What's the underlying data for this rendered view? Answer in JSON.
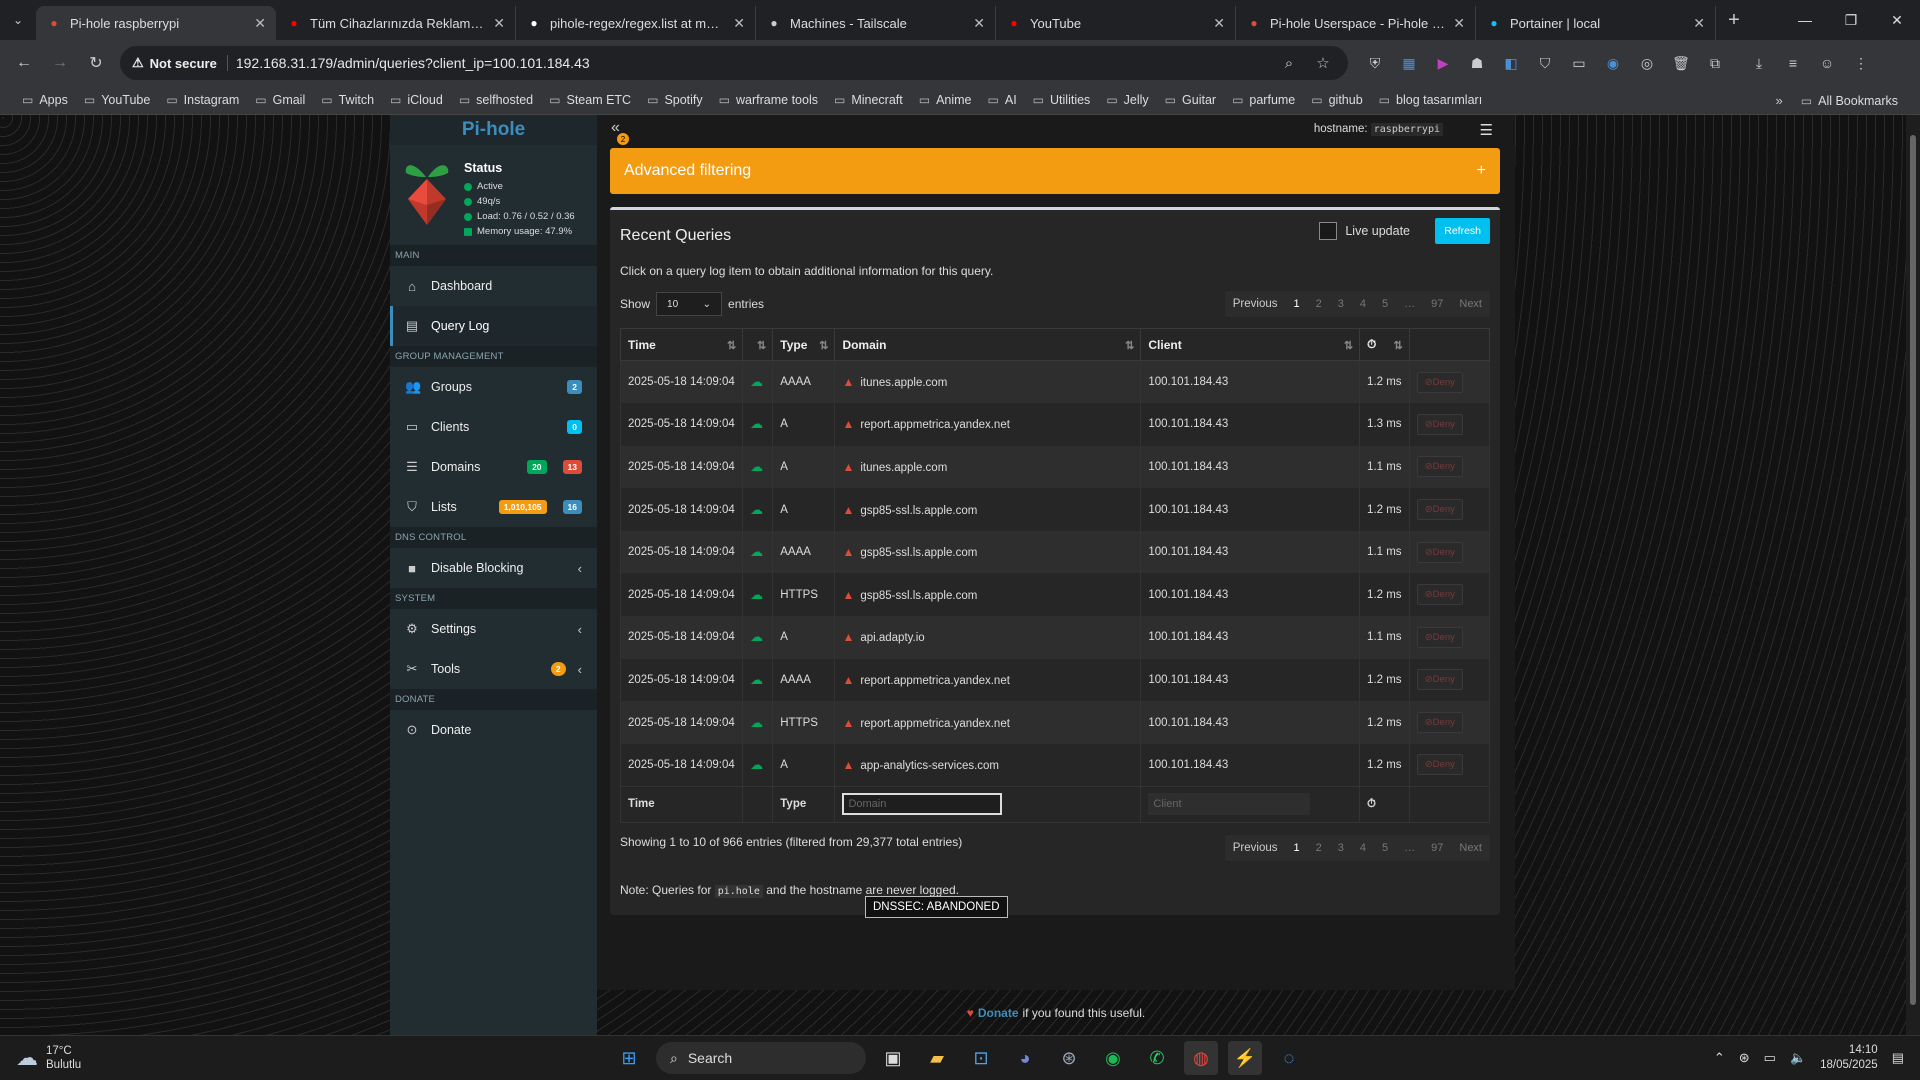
{
  "browser": {
    "tabs": [
      {
        "title": "Pi-hole raspberrypi",
        "icon": "pihole-favicon",
        "color": "#dd4b39"
      },
      {
        "title": "Tüm Cihazlarınızda Reklam ve T",
        "icon": "youtube-favicon",
        "color": "#ff0000"
      },
      {
        "title": "pihole-regex/regex.list at maste",
        "icon": "github-favicon",
        "color": "#ffffff"
      },
      {
        "title": "Machines - Tailscale",
        "icon": "tailscale-favicon",
        "color": "#cccccc"
      },
      {
        "title": "YouTube",
        "icon": "youtube-favicon",
        "color": "#ff0000"
      },
      {
        "title": "Pi-hole Userspace - Pi-hole Co",
        "icon": "pihole-favicon",
        "color": "#dd4b39"
      },
      {
        "title": "Portainer | local",
        "icon": "portainer-favicon",
        "color": "#13bef9"
      }
    ],
    "security_label": "Not secure",
    "url": "192.168.31.179/admin/queries?client_ip=100.101.184.43",
    "bookmarks": [
      "Apps",
      "YouTube",
      "Instagram",
      "Gmail",
      "Twitch",
      "iCloud",
      "selfhosted",
      "Steam ETC",
      "Spotify",
      "warframe tools",
      "Minecraft",
      "Anime",
      "AI",
      "Utilities",
      "Jelly",
      "Guitar",
      "parfume",
      "github",
      "blog tasarımları"
    ],
    "all_bookmarks": "All Bookmarks"
  },
  "sidebar": {
    "logo": "Pi-hole",
    "status_title": "Status",
    "status_items": [
      "Active",
      "49q/s",
      "Load: 0.76 / 0.52 / 0.36",
      "Memory usage: 47.9%"
    ],
    "sections": {
      "main": "MAIN",
      "group": "GROUP MANAGEMENT",
      "dns": "DNS CONTROL",
      "system": "SYSTEM",
      "donate": "DONATE"
    },
    "items": {
      "dashboard": "Dashboard",
      "querylog": "Query Log",
      "groups": "Groups",
      "groups_badge": "2",
      "clients": "Clients",
      "clients_badge": "0",
      "domains": "Domains",
      "domains_badge_allow": "20",
      "domains_badge_deny": "13",
      "lists": "Lists",
      "lists_badge_count": "1,010,105",
      "lists_badge_lists": "16",
      "disable": "Disable Blocking",
      "settings": "Settings",
      "tools": "Tools",
      "tools_badge": "2",
      "donate": "Donate"
    }
  },
  "header": {
    "collapse_badge": "2",
    "hostname_label": "hostname:",
    "hostname_value": "raspberrypi"
  },
  "advanced": {
    "title": "Advanced filtering",
    "toggle": "+"
  },
  "queries": {
    "title": "Recent Queries",
    "live_update": "Live update",
    "refresh": "Refresh",
    "hint": "Click on a query log item to obtain additional information for this query.",
    "show": "Show",
    "entries": "entries",
    "page_size": "10",
    "pager": [
      "Previous",
      "1",
      "2",
      "3",
      "4",
      "5",
      "…",
      "97",
      "Next"
    ],
    "columns": {
      "time": "Time",
      "type": "Type",
      "domain": "Domain",
      "client": "Client"
    },
    "rows": [
      {
        "time": "2025-05-18 14:09:04",
        "type": "AAAA",
        "domain": "itunes.apple.com",
        "client": "100.101.184.43",
        "reply": "1.2 ms"
      },
      {
        "time": "2025-05-18 14:09:04",
        "type": "A",
        "domain": "report.appmetrica.yandex.net",
        "client": "100.101.184.43",
        "reply": "1.3 ms"
      },
      {
        "time": "2025-05-18 14:09:04",
        "type": "A",
        "domain": "itunes.apple.com",
        "client": "100.101.184.43",
        "reply": "1.1 ms"
      },
      {
        "time": "2025-05-18 14:09:04",
        "type": "A",
        "domain": "gsp85-ssl.ls.apple.com",
        "client": "100.101.184.43",
        "reply": "1.2 ms"
      },
      {
        "time": "2025-05-18 14:09:04",
        "type": "AAAA",
        "domain": "gsp85-ssl.ls.apple.com",
        "client": "100.101.184.43",
        "reply": "1.1 ms"
      },
      {
        "time": "2025-05-18 14:09:04",
        "type": "HTTPS",
        "domain": "gsp85-ssl.ls.apple.com",
        "client": "100.101.184.43",
        "reply": "1.2 ms"
      },
      {
        "time": "2025-05-18 14:09:04",
        "type": "A",
        "domain": "api.adapty.io",
        "client": "100.101.184.43",
        "reply": "1.1 ms"
      },
      {
        "time": "2025-05-18 14:09:04",
        "type": "AAAA",
        "domain": "report.appmetrica.yandex.net",
        "client": "100.101.184.43",
        "reply": "1.2 ms"
      },
      {
        "time": "2025-05-18 14:09:04",
        "type": "HTTPS",
        "domain": "report.appmetrica.yandex.net",
        "client": "100.101.184.43",
        "reply": "1.2 ms"
      },
      {
        "time": "2025-05-18 14:09:04",
        "type": "A",
        "domain": "app-analytics-services.com",
        "client": "100.101.184.43",
        "reply": "1.2 ms"
      }
    ],
    "deny_label": "Deny",
    "filter_domain_placeholder": "Domain",
    "filter_client_placeholder": "Client",
    "tooltip": "DNSSEC: ABANDONED",
    "summary": "Showing 1 to 10 of 966 entries (filtered from 29,377 total entries)",
    "note_prefix": "Note: Queries for",
    "note_code": "pi.hole",
    "note_suffix": "and the hostname are never logged."
  },
  "footer": {
    "donate": "Donate",
    "text": "if you found this useful."
  },
  "taskbar": {
    "temp": "17°C",
    "weather": "Bulutlu",
    "search": "Search",
    "time": "14:10",
    "date": "18/05/2025"
  }
}
